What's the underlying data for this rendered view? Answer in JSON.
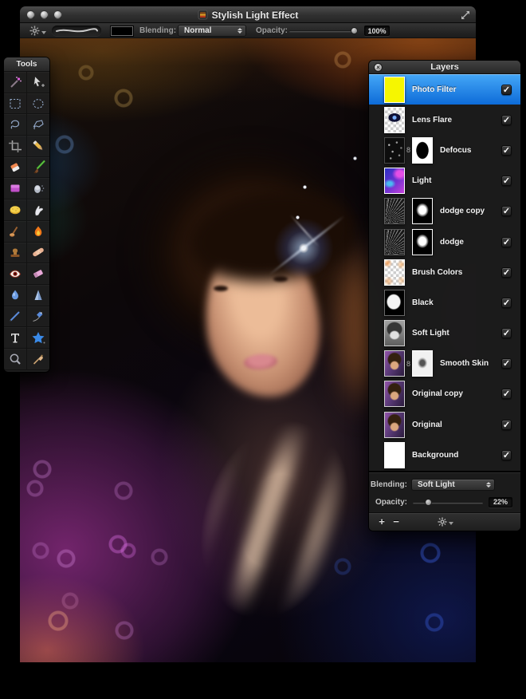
{
  "window": {
    "title": "Stylish Light Effect"
  },
  "toolbar": {
    "blending_label": "Blending:",
    "blending_value": "Normal",
    "opacity_label": "Opacity:",
    "opacity_value": "100%",
    "opacity_percent": 100
  },
  "tools": {
    "title": "Tools",
    "items": [
      "magic-wand-tool",
      "move-tool",
      "rect-marquee-tool",
      "ellipse-marquee-tool",
      "lasso-tool",
      "polygon-lasso-tool",
      "crop-tool",
      "pencil-tool",
      "eraser-tool",
      "paintbrush-tool",
      "color-fill-tool",
      "airbrush-tool",
      "sponge-tool",
      "smudge-tool",
      "burn-tool",
      "flame-tool",
      "stamp-tool",
      "heal-tool",
      "red-eye-tool",
      "soft-eraser-tool",
      "blur-tool",
      "sharpen-tool",
      "line-tool",
      "pen-tool",
      "type-tool",
      "shape-tool",
      "zoom-tool",
      "eyedropper-tool"
    ]
  },
  "layers": {
    "title": "Layers",
    "items": [
      {
        "name": "Photo Filter",
        "thumb": "yellow",
        "selected": true,
        "checked": true
      },
      {
        "name": "Lens Flare",
        "thumb": "flare",
        "checked": true
      },
      {
        "name": "Defocus",
        "thumb": "speckle",
        "mask": true,
        "mask_thumb": "white-blob",
        "linked": true,
        "checked": true
      },
      {
        "name": "Light",
        "thumb": "light",
        "checked": true
      },
      {
        "name": "dodge copy",
        "thumb": "rays",
        "mask": true,
        "mask_thumb": "black-blob",
        "linked": false,
        "checked": true
      },
      {
        "name": "dodge",
        "thumb": "rays",
        "mask": true,
        "mask_thumb": "black-blob",
        "linked": false,
        "checked": true
      },
      {
        "name": "Brush Colors",
        "thumb": "checker-orange",
        "checked": true
      },
      {
        "name": "Black",
        "thumb": "black-blob",
        "checked": true
      },
      {
        "name": "Soft Light",
        "thumb": "portrait-gray",
        "checked": true
      },
      {
        "name": "Smooth Skin",
        "thumb": "portrait",
        "mask": true,
        "mask_thumb": "sketch",
        "linked": true,
        "checked": true
      },
      {
        "name": "Original copy",
        "thumb": "portrait",
        "checked": true
      },
      {
        "name": "Original",
        "thumb": "portrait",
        "checked": true
      },
      {
        "name": "Background",
        "thumb": "white",
        "checked": true
      }
    ],
    "footer": {
      "blending_label": "Blending:",
      "blending_value": "Soft Light",
      "opacity_label": "Opacity:",
      "opacity_value": "22%",
      "opacity_percent": 22,
      "add_label": "+",
      "remove_label": "−"
    }
  },
  "icons": {
    "link_glyph": "8",
    "check_glyph": "✓",
    "close_glyph": "×"
  },
  "colors": {
    "selection_blue": "#1f85ec",
    "canvas_purple": "#8c2c80",
    "canvas_orange": "#da782c",
    "canvas_navy": "#122270"
  }
}
